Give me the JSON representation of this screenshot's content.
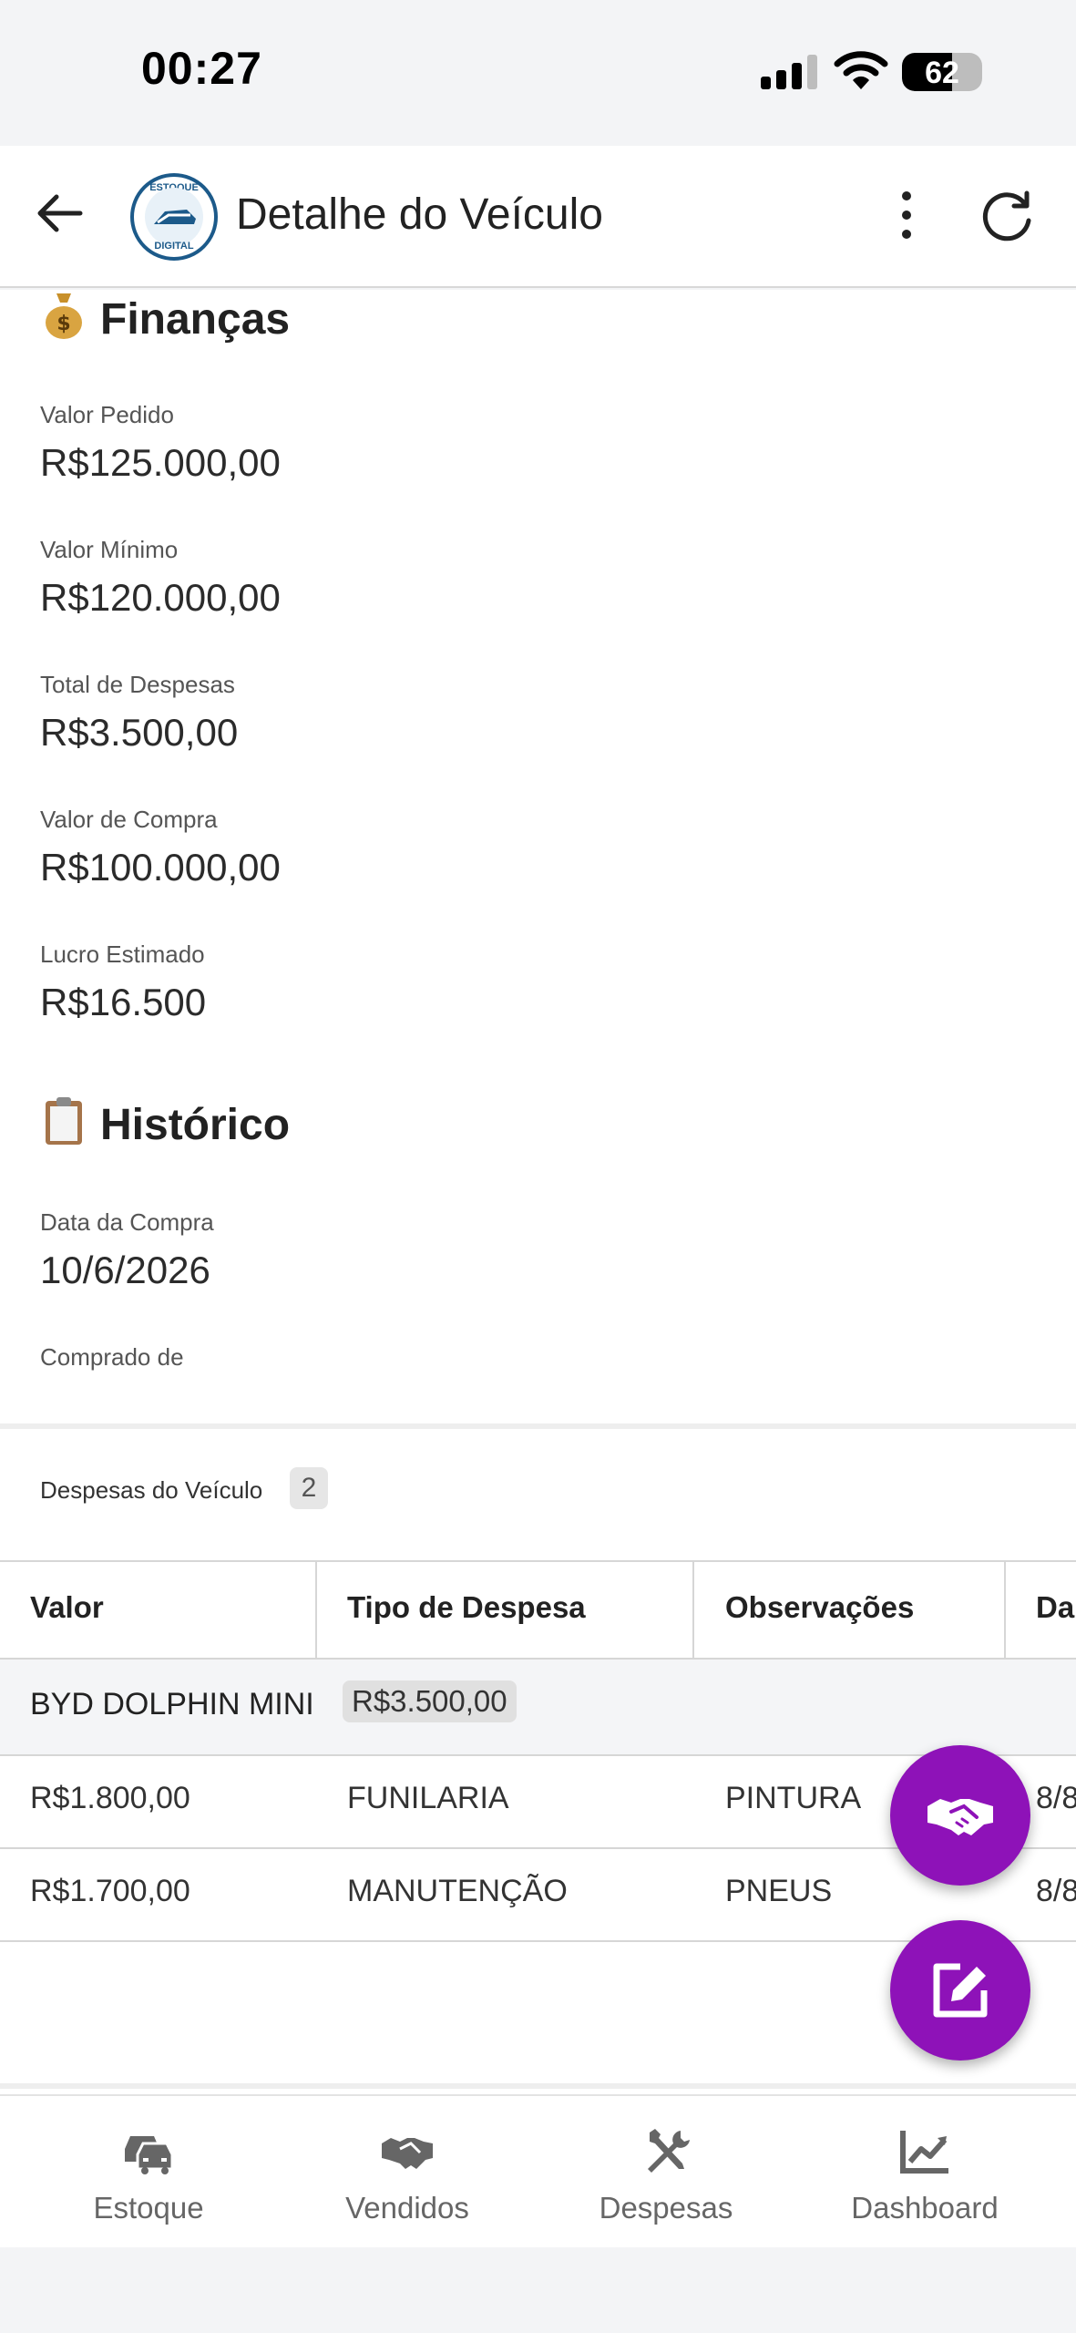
{
  "status_bar": {
    "time": "00:27",
    "battery": "62",
    "battery_level": 0.62
  },
  "app_bar": {
    "title": "Detalhe do Veículo",
    "logo_top": "ESTOQUE",
    "logo_bottom": "DIGITAL"
  },
  "financas": {
    "title": "Finanças",
    "fields": [
      {
        "label": "Valor Pedido",
        "value": "R$125.000,00"
      },
      {
        "label": "Valor Mínimo",
        "value": "R$120.000,00"
      },
      {
        "label": "Total de Despesas",
        "value": "R$3.500,00"
      },
      {
        "label": "Valor de Compra",
        "value": "R$100.000,00"
      },
      {
        "label": "Lucro Estimado",
        "value": "R$16.500"
      }
    ]
  },
  "historico": {
    "title": "Histórico",
    "fields": [
      {
        "label": "Data da Compra",
        "value": "10/6/2026"
      },
      {
        "label": "Comprado de",
        "value": ""
      }
    ]
  },
  "despesas": {
    "label": "Despesas do Veículo",
    "count": "2",
    "columns": [
      "Valor",
      "Tipo de Despesa",
      "Observações",
      "Da"
    ],
    "group": {
      "name": "BYD DOLPHIN MINI",
      "total": "R$3.500,00"
    },
    "rows": [
      {
        "valor": "R$1.800,00",
        "tipo": "FUNILARIA",
        "obs": "PINTURA",
        "data": "8/8"
      },
      {
        "valor": "R$1.700,00",
        "tipo": "MANUTENÇÃO",
        "obs": "PNEUS",
        "data": "8/8"
      }
    ]
  },
  "fabs": {
    "sell_icon": "handshake-icon",
    "edit_icon": "edit-icon"
  },
  "bottom_nav": [
    {
      "label": "Estoque",
      "icon": "car-icon"
    },
    {
      "label": "Vendidos",
      "icon": "handshake-icon"
    },
    {
      "label": "Despesas",
      "icon": "tools-icon"
    },
    {
      "label": "Dashboard",
      "icon": "chart-line-icon"
    }
  ],
  "colors": {
    "accent": "#8e12b8",
    "logo_blue": "#1c5a8a"
  }
}
